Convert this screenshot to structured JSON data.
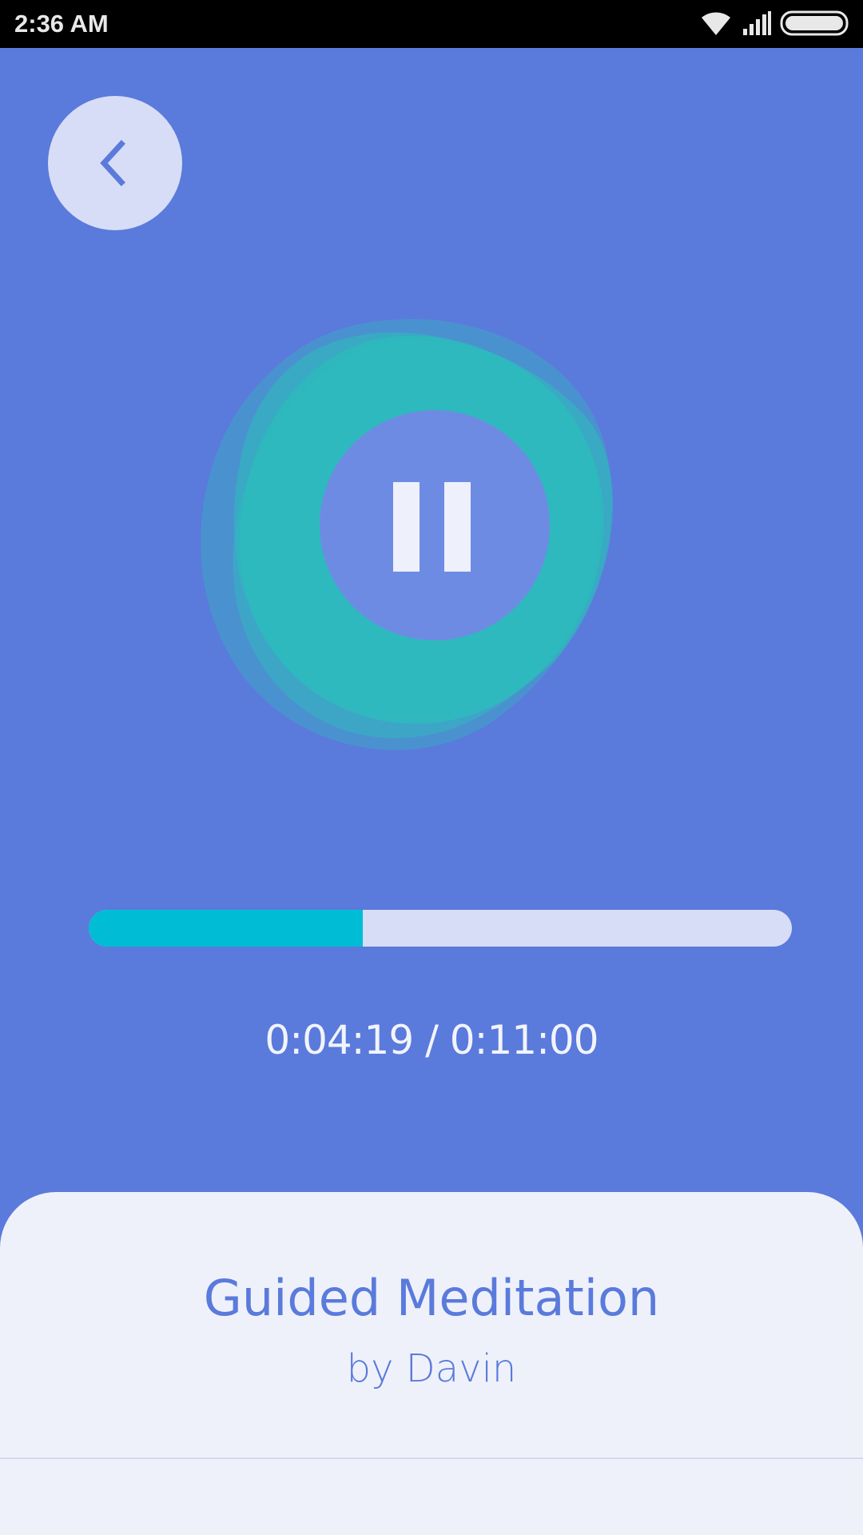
{
  "status_bar": {
    "time": "2:36 AM",
    "icons": [
      "wifi-icon",
      "signal-icon",
      "battery-icon"
    ]
  },
  "navigation": {
    "back_icon": "chevron-left-icon"
  },
  "player": {
    "state": "playing",
    "control_icon": "pause-icon",
    "progress_fraction": 0.39,
    "time_readout": "0:04:19 / 0:11:00"
  },
  "track": {
    "title": "Guided Meditation",
    "author": "by Davin"
  },
  "colors": {
    "background": "#5a7adc",
    "accent": "#00bcd4",
    "blob": "#2fbcbc",
    "track": "#d7ddf6",
    "sheet": "#eff1fa"
  }
}
